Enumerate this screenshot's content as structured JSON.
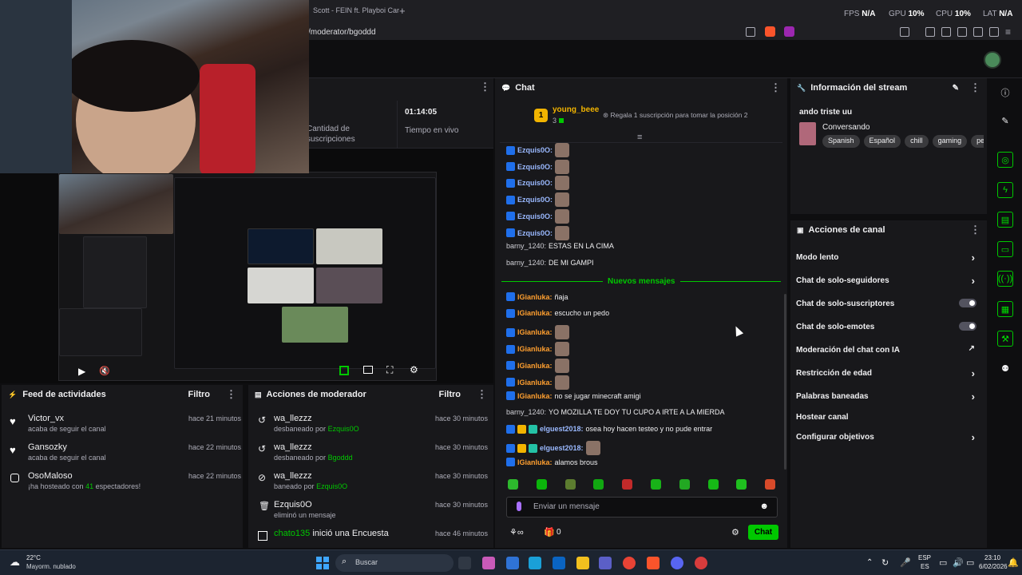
{
  "browser": {
    "tab_title": "Scott - FEIN ft. Playboi Car",
    "tab_plus": "+",
    "url": "/moderator/bgoddd",
    "perf": [
      {
        "label": "FPS",
        "value": "N/A"
      },
      {
        "label": "GPU",
        "value": "10%"
      },
      {
        "label": "CPU",
        "value": "10%"
      },
      {
        "label": "LAT",
        "value": "N/A"
      }
    ]
  },
  "stats": {
    "subs_label_1": "Cantidad de",
    "subs_label_2": "suscripciones",
    "live_time": "01:14:05",
    "live_label": "Tiempo en vivo"
  },
  "activity_feed": {
    "title": "Feed de actividades",
    "filter": "Filtro",
    "items": [
      {
        "icon": "heart-icon",
        "name": "Victor_vx",
        "sub": "acaba de seguir el canal",
        "time": "hace 21 minutos"
      },
      {
        "icon": "heart-icon",
        "name": "Gansozky",
        "sub": "acaba de seguir el canal",
        "time": "hace 22 minutos"
      },
      {
        "icon": "host-icon",
        "name": "OsoMaloso",
        "sub_pre": "¡ha hosteado con",
        "sub_num": "41",
        "sub_post": "espectadores!",
        "time": "hace 22 minutos"
      }
    ]
  },
  "mod_actions": {
    "title": "Acciones de moderador",
    "filter": "Filtro",
    "items": [
      {
        "icon": "undo-icon",
        "name": "wa_llezzz",
        "sub_pre": "desbaneado por",
        "by": "Ezquis0O",
        "time": "hace 30 minutos"
      },
      {
        "icon": "undo-icon",
        "name": "wa_llezzz",
        "sub_pre": "desbaneado por",
        "by": "Bgoddd",
        "time": "hace 30 minutos"
      },
      {
        "icon": "ban-icon",
        "name": "wa_llezzz",
        "sub_pre": "baneado por",
        "by": "Ezquis0O",
        "time": "hace 30 minutos"
      },
      {
        "icon": "trash-icon",
        "name": "Ezquis0O",
        "sub_pre": "eliminó un mensaje",
        "by": "",
        "time": "hace 30 minutos"
      },
      {
        "icon": "poll-icon",
        "name": "chato135",
        "name_suffix": "inició una Encuesta",
        "sub_pre": "",
        "by": "",
        "time": "hace 46 minutos"
      }
    ]
  },
  "chat": {
    "title": "Chat",
    "top_rank": "1",
    "top_user": "young_beee",
    "top_count": "3",
    "gift_prompt": "Regala 1 suscripción para tomar la posición 2",
    "new_messages": "Nuevos mensajes",
    "messages_before": [
      {
        "user": "Ezquis0O:",
        "text": "",
        "emote": true
      },
      {
        "user": "Ezquis0O:",
        "text": "",
        "emote": true
      },
      {
        "user": "Ezquis0O:",
        "text": "",
        "emote": true
      },
      {
        "user": "Ezquis0O:",
        "text": "",
        "emote": true
      },
      {
        "user": "Ezquis0O:",
        "text": "",
        "emote": true
      },
      {
        "user": "Ezquis0O:",
        "text": "",
        "emote": true
      },
      {
        "user": "barny_1240:",
        "text": "ESTAS EN LA CIMA",
        "emote": false
      },
      {
        "user": "barny_1240:",
        "text": "DE MI GAMPI",
        "emote": false
      }
    ],
    "messages_after": [
      {
        "user": "lGianluka:",
        "text": "ñaja",
        "emote": false
      },
      {
        "user": "lGianluka:",
        "text": "escucho un pedo",
        "emote": false
      },
      {
        "user": "lGianluka:",
        "text": "",
        "emote": true
      },
      {
        "user": "lGianluka:",
        "text": "",
        "emote": true
      },
      {
        "user": "lGianluka:",
        "text": "",
        "emote": true
      },
      {
        "user": "lGianluka:",
        "text": "",
        "emote": true
      },
      {
        "user": "lGianluka:",
        "text": "no se jugar minecraft amigi",
        "emote": false
      },
      {
        "user": "barny_1240:",
        "text": "YO MOZILLA TE DOY TU CUPO A IRTE A LA MIERDA",
        "emote": false
      },
      {
        "user": "elguest2018:",
        "text": "osea hoy hacen testeo y no pude entrar",
        "emote": false
      },
      {
        "user": "elguest2018:",
        "text": "",
        "emote": true
      },
      {
        "user": "lGianluka:",
        "text": "alamos brous",
        "emote": false
      }
    ],
    "input_placeholder": "Enviar un mensaje",
    "gift_count": "0",
    "send_label": "Chat"
  },
  "stream_info": {
    "title": "Información del stream",
    "stream_title": "ando triste uu",
    "category": "Conversando",
    "tags": [
      "Spanish",
      "Español",
      "chill",
      "gaming",
      "pe"
    ]
  },
  "channel_actions": {
    "title": "Acciones de canal",
    "items": [
      {
        "label": "Modo lento",
        "control": "chevron"
      },
      {
        "label": "Chat de solo-seguidores",
        "control": "chevron"
      },
      {
        "label": "Chat de solo-suscriptores",
        "control": "toggle"
      },
      {
        "label": "Chat de solo-emotes",
        "control": "toggle"
      },
      {
        "label": "Moderación del chat con IA",
        "control": "external"
      },
      {
        "label": "Restricción de edad",
        "control": "chevron"
      },
      {
        "label": "Palabras baneadas",
        "control": "chevron"
      },
      {
        "label": "Hostear canal",
        "control": "none"
      },
      {
        "label": "Configurar objetivos",
        "control": "chevron"
      }
    ]
  },
  "taskbar": {
    "weather_temp": "22°C",
    "weather_desc": "Mayorm. nublado",
    "search": "Buscar",
    "lang_1": "ESP",
    "lang_2": "ES",
    "time": "23:10",
    "date": "6/02/2026"
  },
  "colors": {
    "accent_green": "#00c800",
    "panel_bg": "#18181b",
    "page_bg": "#0e0e10"
  }
}
